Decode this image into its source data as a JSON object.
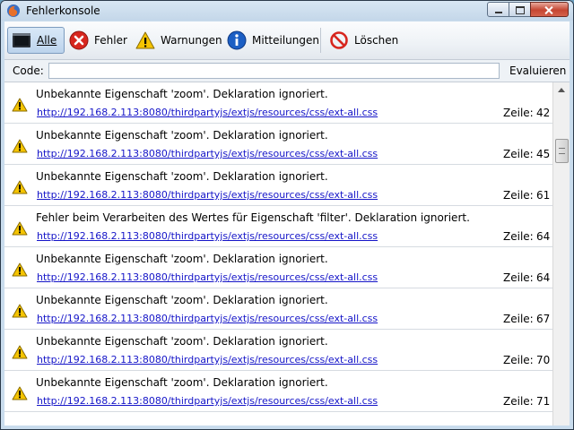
{
  "window": {
    "title": "Fehlerkonsole"
  },
  "toolbar": {
    "buttons": [
      {
        "label": "Alle",
        "icon": "all-messages-icon",
        "active": true
      },
      {
        "label": "Fehler",
        "icon": "error-icon",
        "active": false
      },
      {
        "label": "Warnungen",
        "icon": "warning-icon",
        "active": false
      },
      {
        "label": "Mitteilungen",
        "icon": "info-icon",
        "active": false
      },
      {
        "label": "Löschen",
        "icon": "clear-icon",
        "active": false
      }
    ]
  },
  "code": {
    "label": "Code:",
    "value": "",
    "evaluate_label": "Evaluieren"
  },
  "line_label": "Zeile:",
  "entries": [
    {
      "message": "Unbekannte Eigenschaft 'zoom'.  Deklaration ignoriert.",
      "source": "http://192.168.2.113:8080/thirdpartyjs/extjs/resources/css/ext-all.css",
      "line": "42"
    },
    {
      "message": "Unbekannte Eigenschaft 'zoom'.  Deklaration ignoriert.",
      "source": "http://192.168.2.113:8080/thirdpartyjs/extjs/resources/css/ext-all.css",
      "line": "45"
    },
    {
      "message": "Unbekannte Eigenschaft 'zoom'.  Deklaration ignoriert.",
      "source": "http://192.168.2.113:8080/thirdpartyjs/extjs/resources/css/ext-all.css",
      "line": "61"
    },
    {
      "message": "Fehler beim Verarbeiten des Wertes für Eigenschaft 'filter'.  Deklaration ignoriert.",
      "source": "http://192.168.2.113:8080/thirdpartyjs/extjs/resources/css/ext-all.css",
      "line": "64"
    },
    {
      "message": "Unbekannte Eigenschaft 'zoom'.  Deklaration ignoriert.",
      "source": "http://192.168.2.113:8080/thirdpartyjs/extjs/resources/css/ext-all.css",
      "line": "64"
    },
    {
      "message": "Unbekannte Eigenschaft 'zoom'.  Deklaration ignoriert.",
      "source": "http://192.168.2.113:8080/thirdpartyjs/extjs/resources/css/ext-all.css",
      "line": "67"
    },
    {
      "message": "Unbekannte Eigenschaft 'zoom'.  Deklaration ignoriert.",
      "source": "http://192.168.2.113:8080/thirdpartyjs/extjs/resources/css/ext-all.css",
      "line": "70"
    },
    {
      "message": "Unbekannte Eigenschaft 'zoom'.  Deklaration ignoriert.",
      "source": "http://192.168.2.113:8080/thirdpartyjs/extjs/resources/css/ext-all.css",
      "line": "71"
    }
  ],
  "colors": {
    "link": "#1515c8",
    "warning_fill": "#f5c400",
    "error_fill": "#d7261e",
    "info_fill": "#1c5fc4"
  }
}
